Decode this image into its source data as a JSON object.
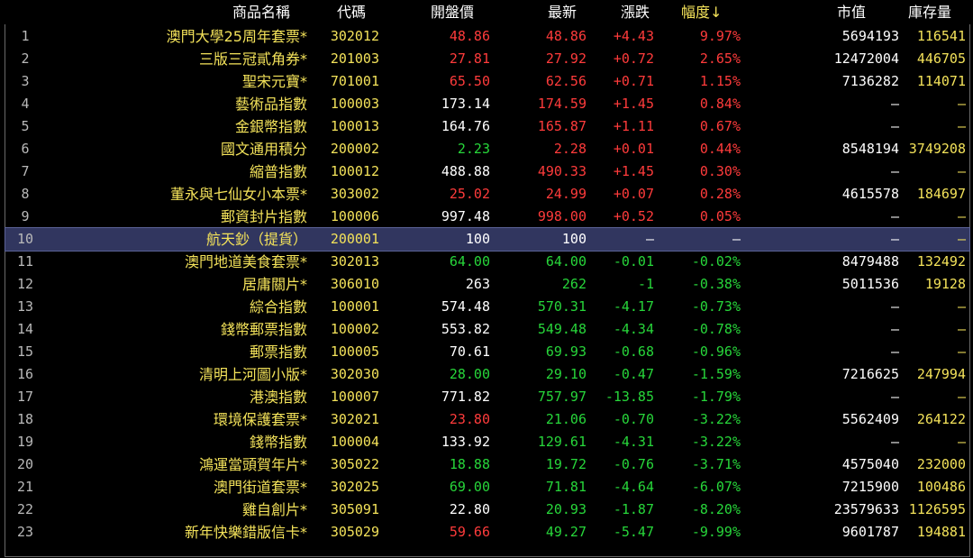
{
  "colors": {
    "background": "#000000",
    "up": "#ff3b3b",
    "down": "#27d63a",
    "flat": "#ffffff",
    "name": "#f3e25a",
    "selected_row": "#31365f"
  },
  "header": {
    "name": "商品名稱",
    "code": "代碼",
    "open": "開盤價",
    "last": "最新",
    "change": "漲跌",
    "pct_change": "幅度↓",
    "market_cap": "市值",
    "stock": "庫存量"
  },
  "selected_index": 10,
  "rows": [
    {
      "no": "1",
      "name": "澳門大學25周年套票*",
      "code": "302012",
      "open": "48.86",
      "open_dir": "up",
      "last": "48.86",
      "last_dir": "up",
      "change": "+4.43",
      "pct": "9.97%",
      "dir": "up",
      "mcap": "5694193",
      "stock": "116541"
    },
    {
      "no": "2",
      "name": "三版三冠貳角券*",
      "code": "201003",
      "open": "27.81",
      "open_dir": "up",
      "last": "27.92",
      "last_dir": "up",
      "change": "+0.72",
      "pct": "2.65%",
      "dir": "up",
      "mcap": "12472004",
      "stock": "446705"
    },
    {
      "no": "3",
      "name": "聖宋元寶*",
      "code": "701001",
      "open": "65.50",
      "open_dir": "up",
      "last": "62.56",
      "last_dir": "up",
      "change": "+0.71",
      "pct": "1.15%",
      "dir": "up",
      "mcap": "7136282",
      "stock": "114071"
    },
    {
      "no": "4",
      "name": "藝術品指數",
      "code": "100003",
      "open": "173.14",
      "open_dir": "flat",
      "last": "174.59",
      "last_dir": "up",
      "change": "+1.45",
      "pct": "0.84%",
      "dir": "up",
      "mcap": "—",
      "stock": "—"
    },
    {
      "no": "5",
      "name": "金銀幣指數",
      "code": "100013",
      "open": "164.76",
      "open_dir": "flat",
      "last": "165.87",
      "last_dir": "up",
      "change": "+1.11",
      "pct": "0.67%",
      "dir": "up",
      "mcap": "—",
      "stock": "—"
    },
    {
      "no": "6",
      "name": "國文通用積分",
      "code": "200002",
      "open": "2.23",
      "open_dir": "down",
      "last": "2.28",
      "last_dir": "up",
      "change": "+0.01",
      "pct": "0.44%",
      "dir": "up",
      "mcap": "8548194",
      "stock": "3749208"
    },
    {
      "no": "7",
      "name": "縮普指數",
      "code": "100012",
      "open": "488.88",
      "open_dir": "flat",
      "last": "490.33",
      "last_dir": "up",
      "change": "+1.45",
      "pct": "0.30%",
      "dir": "up",
      "mcap": "—",
      "stock": "—"
    },
    {
      "no": "8",
      "name": "董永與七仙女小本票*",
      "code": "303002",
      "open": "25.02",
      "open_dir": "up",
      "last": "24.99",
      "last_dir": "up",
      "change": "+0.07",
      "pct": "0.28%",
      "dir": "up",
      "mcap": "4615578",
      "stock": "184697"
    },
    {
      "no": "9",
      "name": "郵資封片指數",
      "code": "100006",
      "open": "997.48",
      "open_dir": "flat",
      "last": "998.00",
      "last_dir": "up",
      "change": "+0.52",
      "pct": "0.05%",
      "dir": "up",
      "mcap": "—",
      "stock": "—"
    },
    {
      "no": "10",
      "name": "航天鈔（提貨）",
      "code": "200001",
      "open": "100",
      "open_dir": "flat",
      "last": "100",
      "last_dir": "flat",
      "change": "—",
      "pct": "—",
      "dir": "flat",
      "mcap": "—",
      "stock": "—"
    },
    {
      "no": "11",
      "name": "澳門地道美食套票*",
      "code": "302013",
      "open": "64.00",
      "open_dir": "down",
      "last": "64.00",
      "last_dir": "down",
      "change": "-0.01",
      "pct": "-0.02%",
      "dir": "down",
      "mcap": "8479488",
      "stock": "132492"
    },
    {
      "no": "12",
      "name": "居庸關片*",
      "code": "306010",
      "open": "263",
      "open_dir": "flat",
      "last": "262",
      "last_dir": "down",
      "change": "-1",
      "pct": "-0.38%",
      "dir": "down",
      "mcap": "5011536",
      "stock": "19128"
    },
    {
      "no": "13",
      "name": "綜合指數",
      "code": "100001",
      "open": "574.48",
      "open_dir": "flat",
      "last": "570.31",
      "last_dir": "down",
      "change": "-4.17",
      "pct": "-0.73%",
      "dir": "down",
      "mcap": "—",
      "stock": "—"
    },
    {
      "no": "14",
      "name": "錢幣郵票指數",
      "code": "100002",
      "open": "553.82",
      "open_dir": "flat",
      "last": "549.48",
      "last_dir": "down",
      "change": "-4.34",
      "pct": "-0.78%",
      "dir": "down",
      "mcap": "—",
      "stock": "—"
    },
    {
      "no": "15",
      "name": "郵票指數",
      "code": "100005",
      "open": "70.61",
      "open_dir": "flat",
      "last": "69.93",
      "last_dir": "down",
      "change": "-0.68",
      "pct": "-0.96%",
      "dir": "down",
      "mcap": "—",
      "stock": "—"
    },
    {
      "no": "16",
      "name": "清明上河圖小版*",
      "code": "302030",
      "open": "28.00",
      "open_dir": "down",
      "last": "29.10",
      "last_dir": "down",
      "change": "-0.47",
      "pct": "-1.59%",
      "dir": "down",
      "mcap": "7216625",
      "stock": "247994"
    },
    {
      "no": "17",
      "name": "港澳指數",
      "code": "100007",
      "open": "771.82",
      "open_dir": "flat",
      "last": "757.97",
      "last_dir": "down",
      "change": "-13.85",
      "pct": "-1.79%",
      "dir": "down",
      "mcap": "—",
      "stock": "—"
    },
    {
      "no": "18",
      "name": "環境保護套票*",
      "code": "302021",
      "open": "23.80",
      "open_dir": "up",
      "last": "21.06",
      "last_dir": "down",
      "change": "-0.70",
      "pct": "-3.22%",
      "dir": "down",
      "mcap": "5562409",
      "stock": "264122"
    },
    {
      "no": "19",
      "name": "錢幣指數",
      "code": "100004",
      "open": "133.92",
      "open_dir": "flat",
      "last": "129.61",
      "last_dir": "down",
      "change": "-4.31",
      "pct": "-3.22%",
      "dir": "down",
      "mcap": "—",
      "stock": "—"
    },
    {
      "no": "20",
      "name": "鴻運當頭賀年片*",
      "code": "305022",
      "open": "18.88",
      "open_dir": "down",
      "last": "19.72",
      "last_dir": "down",
      "change": "-0.76",
      "pct": "-3.71%",
      "dir": "down",
      "mcap": "4575040",
      "stock": "232000"
    },
    {
      "no": "21",
      "name": "澳門街道套票*",
      "code": "302025",
      "open": "69.00",
      "open_dir": "down",
      "last": "71.81",
      "last_dir": "down",
      "change": "-4.64",
      "pct": "-6.07%",
      "dir": "down",
      "mcap": "7215900",
      "stock": "100486"
    },
    {
      "no": "22",
      "name": "雞自創片*",
      "code": "305091",
      "open": "22.80",
      "open_dir": "flat",
      "last": "20.93",
      "last_dir": "down",
      "change": "-1.87",
      "pct": "-8.20%",
      "dir": "down",
      "mcap": "23579633",
      "stock": "1126595"
    },
    {
      "no": "23",
      "name": "新年快樂錯版信卡*",
      "code": "305029",
      "open": "59.66",
      "open_dir": "up",
      "last": "49.27",
      "last_dir": "down",
      "change": "-5.47",
      "pct": "-9.99%",
      "dir": "down",
      "mcap": "9601787",
      "stock": "194881"
    }
  ]
}
